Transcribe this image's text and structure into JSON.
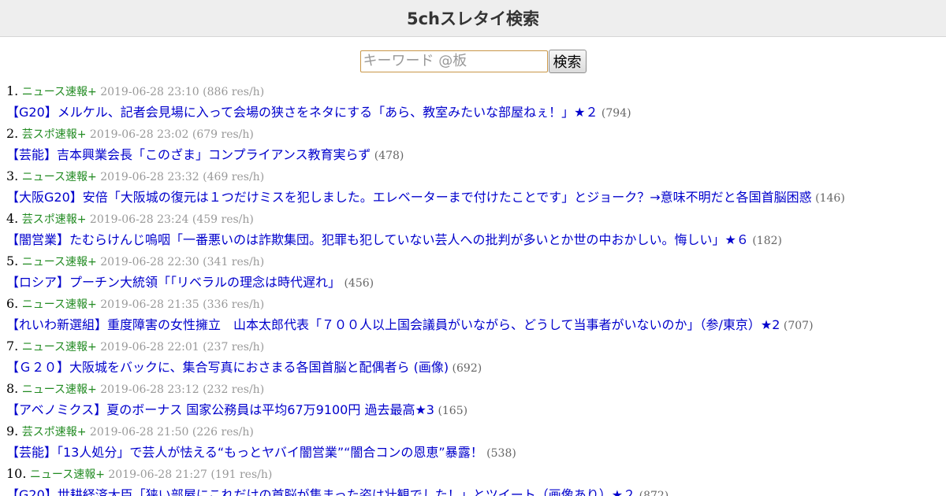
{
  "header": {
    "title": "5chスレタイ検索"
  },
  "search": {
    "placeholder": "キーワード @板",
    "value": "",
    "button_label": "検索"
  },
  "results": [
    {
      "num": "1.",
      "board": "ニュース速報+",
      "datetime": "2019-06-28 23:10",
      "rate": "(886 res/h)",
      "title": "【G20】メルケル、記者会見場に入って会場の狭さをネタにする「あら、教室みたいな部屋ねぇ！」★２",
      "count": "(794)"
    },
    {
      "num": "2.",
      "board": "芸スポ速報+",
      "datetime": "2019-06-28 23:02",
      "rate": "(679 res/h)",
      "title": "【芸能】吉本興業会長「このざま」コンプライアンス教育実らず",
      "count": "(478)"
    },
    {
      "num": "3.",
      "board": "ニュース速報+",
      "datetime": "2019-06-28 23:32",
      "rate": "(469 res/h)",
      "title": "【大阪G20】安倍「大阪城の復元は１つだけミスを犯しました。エレベーターまで付けたことです」とジョーク？→意味不明だと各国首脳困惑",
      "count": "(146)"
    },
    {
      "num": "4.",
      "board": "芸スポ速報+",
      "datetime": "2019-06-28 23:24",
      "rate": "(459 res/h)",
      "title": "【闇営業】たむらけんじ嗚咽「一番悪いのは詐欺集団。犯罪も犯していない芸人への批判が多いとか世の中おかしい。悔しい」★６",
      "count": "(182)"
    },
    {
      "num": "5.",
      "board": "ニュース速報+",
      "datetime": "2019-06-28 22:30",
      "rate": "(341 res/h)",
      "title": "【ロシア】プーチン大統領「「リベラルの理念は時代遅れ」",
      "count": "(456)"
    },
    {
      "num": "6.",
      "board": "ニュース速報+",
      "datetime": "2019-06-28 21:35",
      "rate": "(336 res/h)",
      "title": "【れいわ新選組】重度障害の女性擁立　山本太郎代表「７００人以上国会議員がいながら、どうして当事者がいないのか」（参/東京）★2",
      "count": "(707)"
    },
    {
      "num": "7.",
      "board": "ニュース速報+",
      "datetime": "2019-06-28 22:01",
      "rate": "(237 res/h)",
      "title": "【Ｇ２０】大阪城をバックに、集合写真におさまる各国首脳と配偶者ら (画像)",
      "count": "(692)"
    },
    {
      "num": "8.",
      "board": "ニュース速報+",
      "datetime": "2019-06-28 23:12",
      "rate": "(232 res/h)",
      "title": "【アベノミクス】夏のボーナス 国家公務員は平均67万9100円 過去最高★3",
      "count": "(165)"
    },
    {
      "num": "9.",
      "board": "芸スポ速報+",
      "datetime": "2019-06-28 21:50",
      "rate": "(226 res/h)",
      "title": "【芸能】「13人処分」で芸人が怯える“もっとヤバイ闇営業”“闇合コンの恩恵”暴露！",
      "count": "(538)"
    },
    {
      "num": "10.",
      "board": "ニュース速報+",
      "datetime": "2019-06-28 21:27",
      "rate": "(191 res/h)",
      "title": "【G20】世耕経済大臣「狭い部屋にこれだけの首脳が集まった姿は壮観でした！」とツイート（画像あり）★２",
      "count": "(872)"
    }
  ]
}
